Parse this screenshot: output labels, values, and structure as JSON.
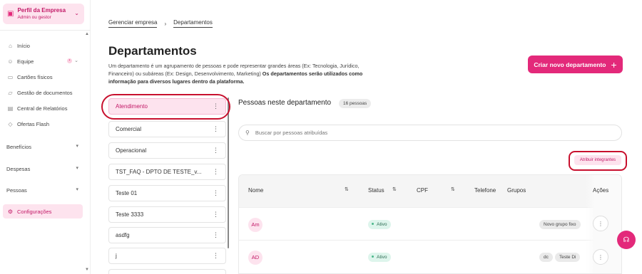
{
  "profile": {
    "title": "Perfil da Empresa",
    "subtitle": "Admin ou gestor",
    "icon": "building-icon"
  },
  "sidebar": {
    "items": [
      {
        "label": "Início",
        "icon": "home-icon"
      },
      {
        "label": "Equipe",
        "icon": "users-icon",
        "badge": "•"
      },
      {
        "label": "Cartões físicos",
        "icon": "card-icon"
      },
      {
        "label": "Gestão de documentos",
        "icon": "folder-icon"
      },
      {
        "label": "Central de Relatórios",
        "icon": "chart-icon"
      },
      {
        "label": "Ofertas Flash",
        "icon": "tag-icon"
      }
    ],
    "sections": [
      {
        "label": "Benefícios"
      },
      {
        "label": "Despesas"
      },
      {
        "label": "Pessoas"
      }
    ],
    "active_item": {
      "label": "Configurações",
      "icon": "gear-icon"
    }
  },
  "breadcrumb": {
    "parent": "Gerenciar empresa",
    "current": "Departamentos"
  },
  "page": {
    "title": "Departamentos",
    "description": "Um departamento é um agrupamento de pessoas e pode representar grandes áreas (Ex: Tecnologia, Jurídico, Financeiro) ou subáreas (Ex: Design, Desenvolvimento, Marketing)",
    "description_bold": "Os departamentos serão utilizados como informação para diversos lugares dentro da plataforma.",
    "create_button": "Criar novo departamento"
  },
  "departments": [
    "Atendimento",
    "Comercial",
    "Operacional",
    "TST_FAQ - DPTO DE TESTE_v...",
    "Teste 01",
    "Teste 3333",
    "asdfg",
    "j"
  ],
  "people": {
    "title": "Pessoas neste departamento",
    "count": "16 pessoas",
    "search_placeholder": "Buscar por pessoas atribuídas",
    "assign_button": "Atribuir integrantes",
    "columns": [
      "Nome",
      "Status",
      "CPF",
      "Telefone",
      "Grupos",
      "Ações"
    ],
    "rows": [
      {
        "initials": "Am",
        "status": "Ativo",
        "groups": [
          "Novo grupo fixo"
        ]
      },
      {
        "initials": "AD",
        "status": "Ativo",
        "groups": [
          "dc",
          "Teste Di"
        ]
      }
    ]
  },
  "colors": {
    "accent": "#e3297a",
    "accent_light": "#fde3ee",
    "annotation_red": "#c8102e"
  }
}
